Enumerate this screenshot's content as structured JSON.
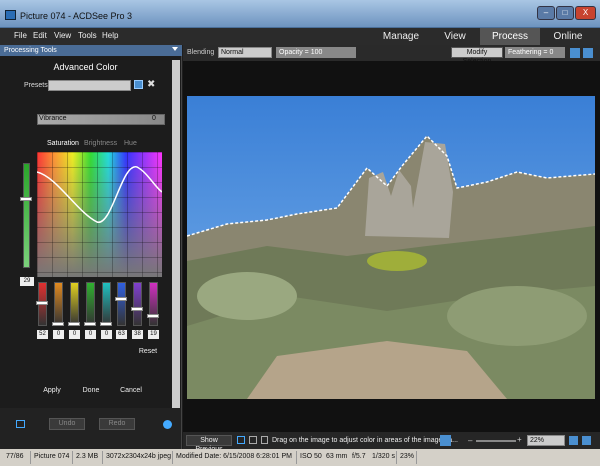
{
  "window": {
    "title": "Picture 074 - ACDSee Pro 3",
    "min": "–",
    "max": "□",
    "close": "X"
  },
  "menu": [
    "File",
    "Edit",
    "View",
    "Tools",
    "Help"
  ],
  "modes": [
    "Manage",
    "View",
    "Process",
    "Online"
  ],
  "panel": {
    "header": "Processing Tools",
    "title": "Advanced Color",
    "presets_label": "Presets",
    "vibrance_label": "Vibrance",
    "vibrance_value": "0",
    "tabs": [
      "Saturation",
      "Brightness",
      "Hue"
    ],
    "master_value": "29",
    "channel_values": [
      "52",
      "0",
      "0",
      "0",
      "0",
      "63",
      "38",
      "19"
    ],
    "channel_levels": [
      52,
      0,
      0,
      0,
      0,
      63,
      38,
      19
    ],
    "channel_colors": [
      "#e03030",
      "#e08a20",
      "#e0d020",
      "#30b030",
      "#20c0c0",
      "#3060e0",
      "#8040d0",
      "#d030c0"
    ],
    "reset": "Reset",
    "apply": "Apply",
    "done": "Done",
    "cancel": "Cancel",
    "undo": "Undo",
    "redo": "Redo"
  },
  "toolbar": {
    "blending_label": "Blending",
    "blending_value": "Normal",
    "opacity": "Opacity = 100",
    "modify_selection": "Modify Selection",
    "feathering": "Feathering = 0"
  },
  "bottom": {
    "show_previous": "Show Previous",
    "hint": "Drag on the image to adjust color in areas of the image ha...",
    "zoom": "22%"
  },
  "status": {
    "index": "77/86",
    "name": "Picture 074",
    "size": "2.3 MB",
    "dims": "3072x2304x24b jpeg",
    "modified": "Modified Date: 6/15/2008 6:28:01 PM",
    "iso": "ISO 50",
    "focal": "63 mm",
    "aperture": "f/5.7",
    "shutter": "1/320 s",
    "zoom": "23%"
  }
}
